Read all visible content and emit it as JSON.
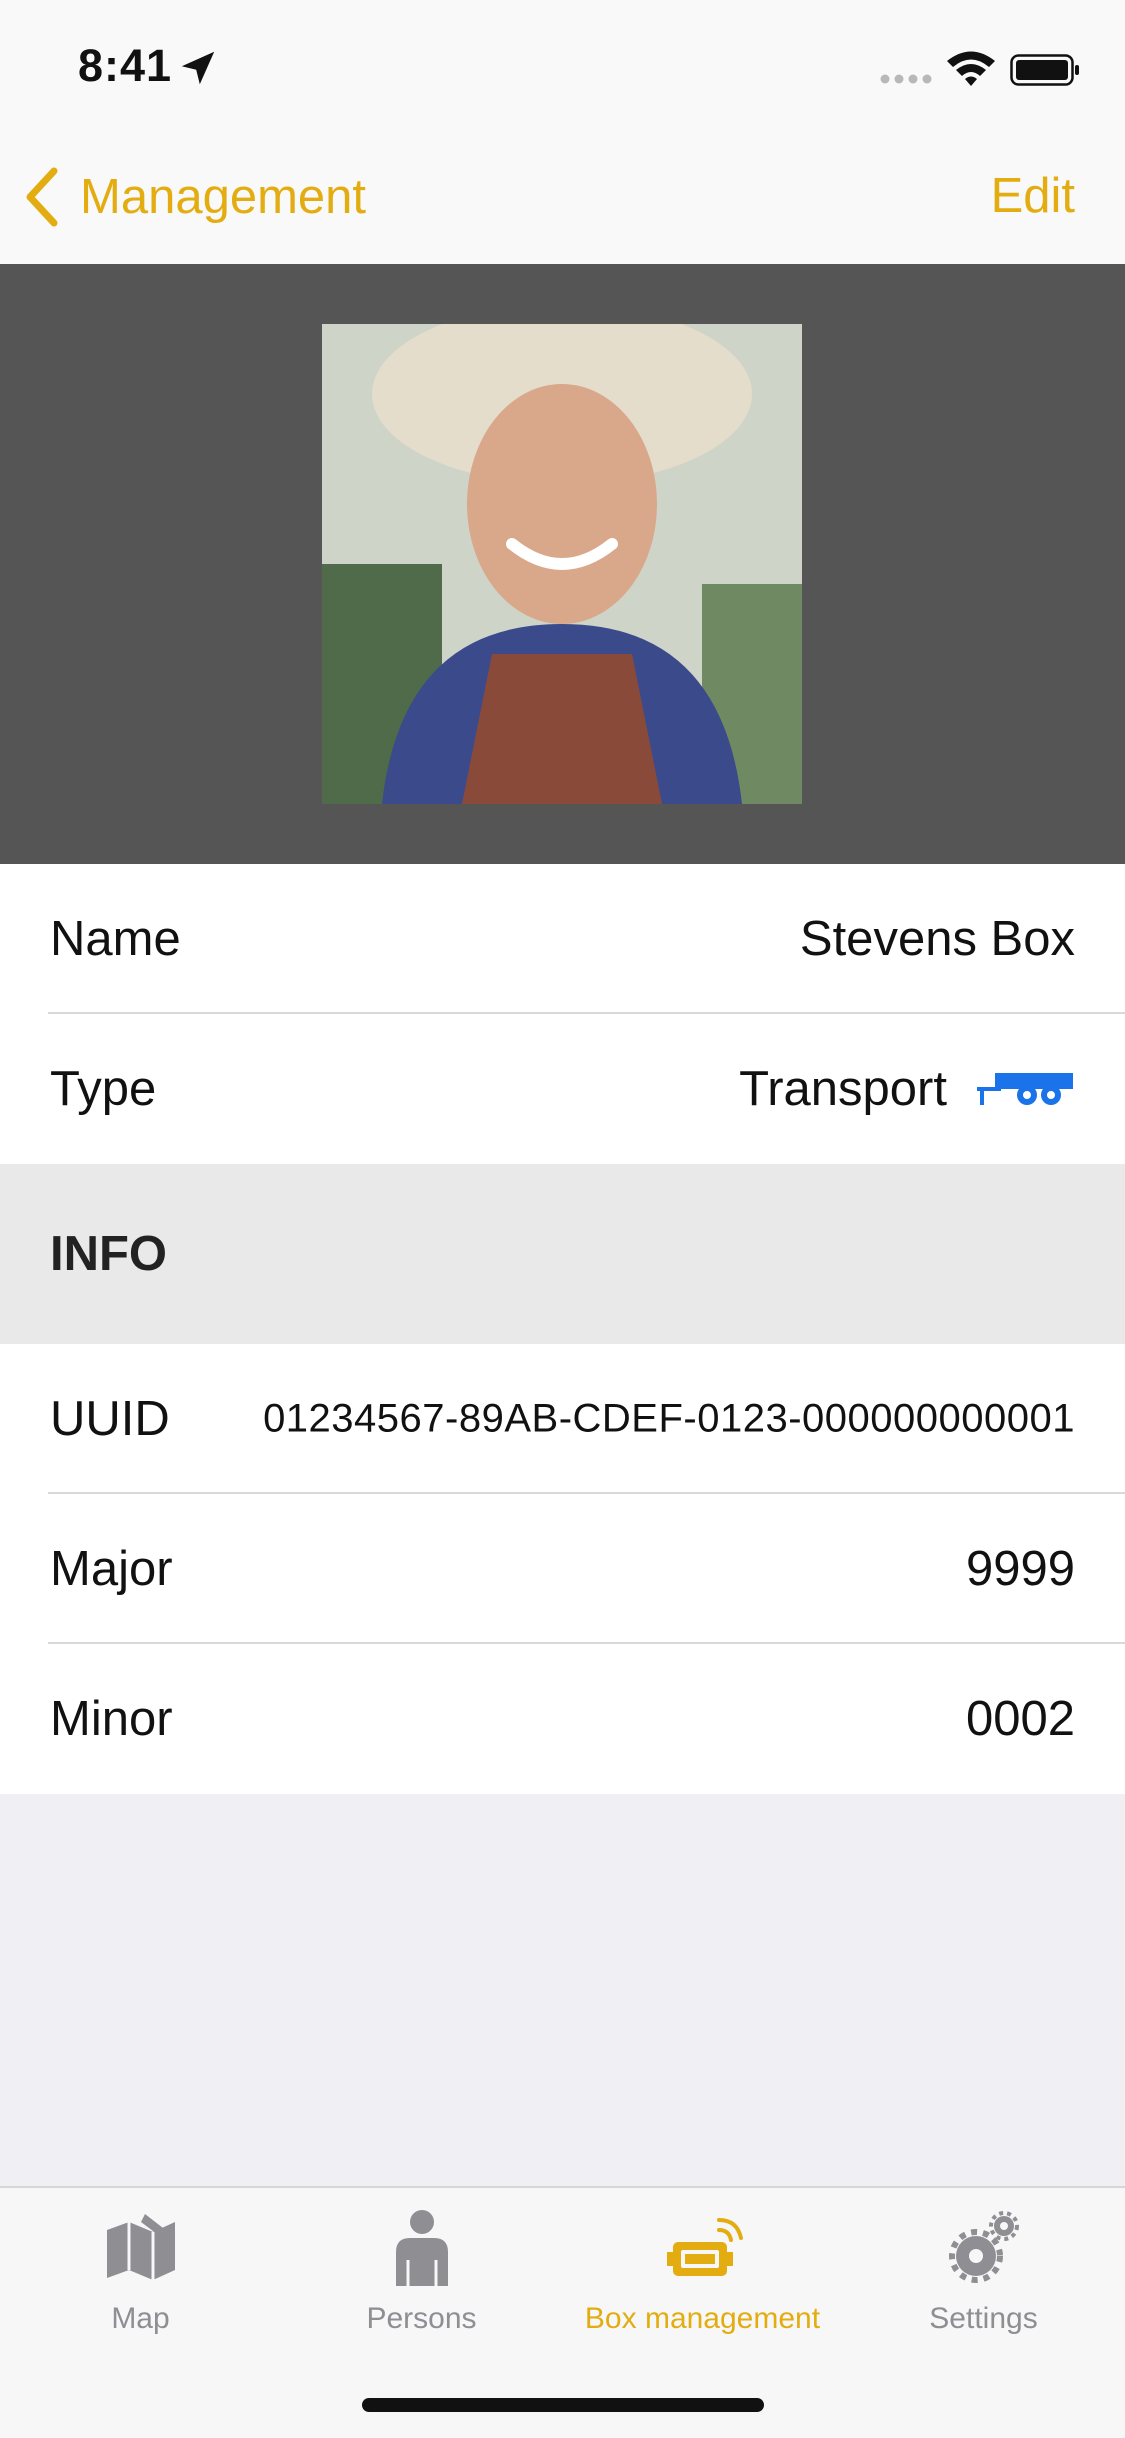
{
  "status_bar": {
    "time": "8:41"
  },
  "nav": {
    "back_label": "Management",
    "edit_label": "Edit"
  },
  "details": {
    "name_label": "Name",
    "name_value": "Stevens Box",
    "type_label": "Type",
    "type_value": "Transport"
  },
  "info": {
    "header": "INFO",
    "uuid_label": "UUID",
    "uuid_value": "01234567-89AB-CDEF-0123-000000000001",
    "major_label": "Major",
    "major_value": "9999",
    "minor_label": "Minor",
    "minor_value": "0002"
  },
  "tabs": [
    {
      "label": "Map",
      "icon": "map-icon"
    },
    {
      "label": "Persons",
      "icon": "person-icon"
    },
    {
      "label": "Box management",
      "icon": "box-signal-icon",
      "active": true
    },
    {
      "label": "Settings",
      "icon": "gears-icon"
    }
  ],
  "colors": {
    "accent": "#e3ad12",
    "photo_background": "#555555",
    "section_header": "#e9e9ea",
    "trailer_icon": "#1a73e8"
  }
}
